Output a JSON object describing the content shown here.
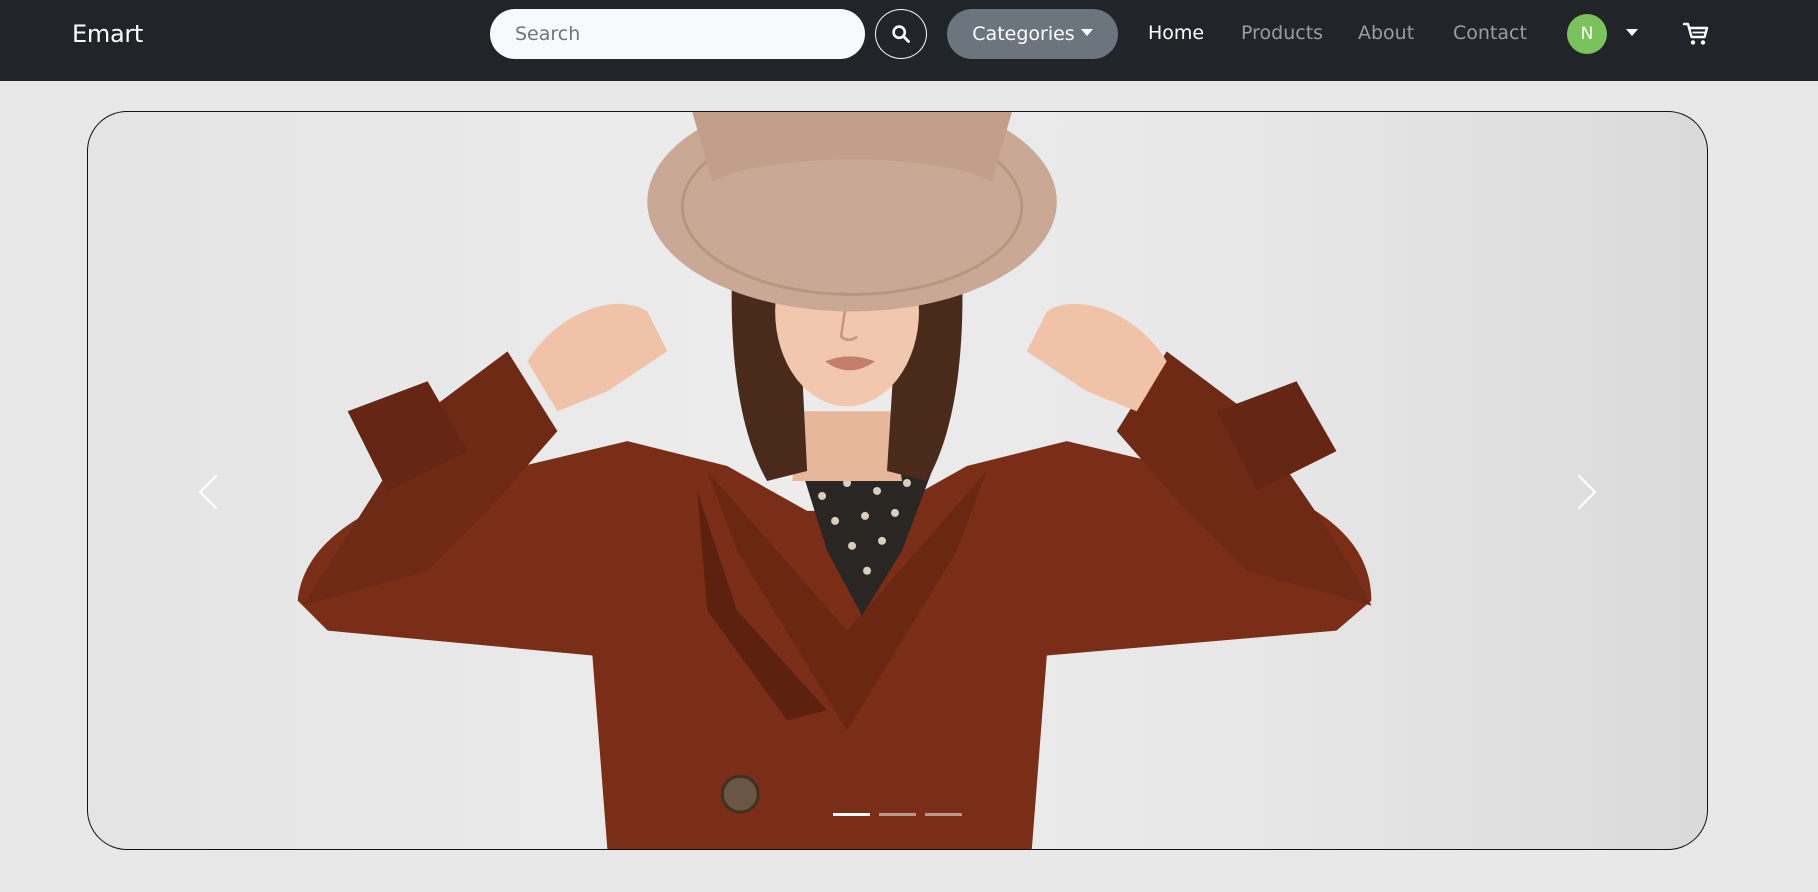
{
  "nav": {
    "brand": "Emart",
    "search_placeholder": "Search",
    "categories_label": "Categories",
    "links": [
      {
        "label": "Home",
        "active": true
      },
      {
        "label": "Products",
        "active": false
      },
      {
        "label": "About",
        "active": false
      },
      {
        "label": "Contact",
        "active": false
      }
    ],
    "avatar_initial": "N",
    "icons": {
      "search": "search-icon",
      "cart": "cart-icon",
      "avatar_menu": "chevron-down-icon"
    }
  },
  "carousel": {
    "image": "hero-image-woman-in-brown-coat-and-hat",
    "slide_count": 3,
    "active_slide": 1,
    "icons": {
      "prev": "chevron-left-icon",
      "next": "chevron-right-icon"
    }
  },
  "colors": {
    "navbar": "#212529",
    "categories_button": "#6c757d",
    "avatar": "#7ac35c",
    "page_background": "#e8e8e8",
    "coat": "#7a2e17"
  }
}
